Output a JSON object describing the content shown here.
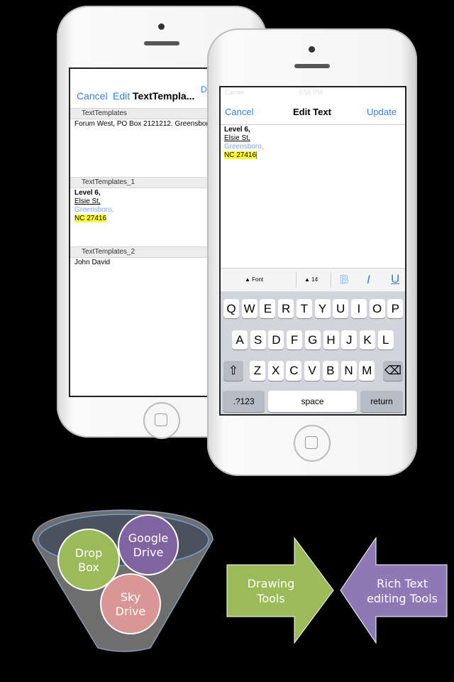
{
  "back_phone": {
    "nav": {
      "cancel": "Cancel",
      "edit": "Edit",
      "title": "TextTempla...",
      "right_cut": "D"
    },
    "sections": [
      {
        "header": "TextTemplates",
        "lines": [
          "Forum West, PO Box 2121212. Greensboro"
        ]
      },
      {
        "header": "TextTemplates_1",
        "lines": [
          "Level 6,",
          "Elsie St,",
          "Greensboro,",
          "NC 27416"
        ]
      },
      {
        "header": "TextTemplates_2",
        "lines": [
          "John David"
        ]
      }
    ]
  },
  "front_phone": {
    "status": {
      "carrier": "Carrier",
      "time": "6:56 PM"
    },
    "nav": {
      "cancel": "Cancel",
      "title": "Edit Text",
      "update": "Update"
    },
    "editor_lines": [
      "Level 6,",
      "Elsie St,",
      "Greensboro,",
      "NC 27416"
    ],
    "toolbar": {
      "font": "Font",
      "size": "14",
      "bold": "B",
      "italic": "I",
      "underline": "U"
    },
    "keyboard": {
      "row1": [
        "Q",
        "W",
        "E",
        "R",
        "T",
        "Y",
        "U",
        "I",
        "O",
        "P"
      ],
      "row2": [
        "A",
        "S",
        "D",
        "F",
        "G",
        "H",
        "J",
        "K",
        "L"
      ],
      "row3": [
        "Z",
        "X",
        "C",
        "V",
        "B",
        "N",
        "M"
      ],
      "numbers": ".?123",
      "space": "space",
      "return": "return"
    }
  },
  "diagram": {
    "circles": [
      {
        "label1": "Drop",
        "label2": "Box",
        "color": "#9bbb59"
      },
      {
        "label1": "Google",
        "label2": "Drive",
        "color": "#8064a2"
      },
      {
        "label1": "Sky",
        "label2": "Drive",
        "color": "#d99694"
      }
    ],
    "arrow_left": {
      "line1": "Drawing",
      "line2": "Tools",
      "color": "#9bbb59"
    },
    "arrow_right": {
      "line1": "Rich Text",
      "line2": "editing Tools",
      "color": "#8e78b6"
    }
  },
  "colors": {
    "ios_blue": "#2f7ff0",
    "highlight": "#ffff33",
    "link_blue": "#7aa3f5"
  }
}
